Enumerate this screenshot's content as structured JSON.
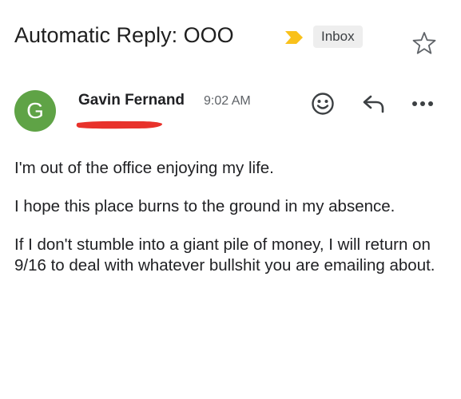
{
  "email": {
    "subject": "Automatic Reply: OOO",
    "label": "Inbox",
    "important_color": "#f9c11b",
    "sender": {
      "name": "Gavin Fernand",
      "initial": "G",
      "avatar_color": "#5fa346",
      "time": "9:02 AM",
      "address_redaction_color": "#e8322b"
    },
    "icons": {
      "importance": "importance-marker-icon",
      "star": "star-icon",
      "emoji": "emoji-reaction-icon",
      "reply": "reply-icon",
      "more": "more-options-icon"
    },
    "body": {
      "paragraphs": [
        "I'm out of the office enjoying my life.",
        "I hope this place burns to the ground in my absence.",
        "If I don't stumble into a giant pile of money, I will return on 9/16 to deal with whatever bullshit you are emailing about."
      ]
    }
  }
}
